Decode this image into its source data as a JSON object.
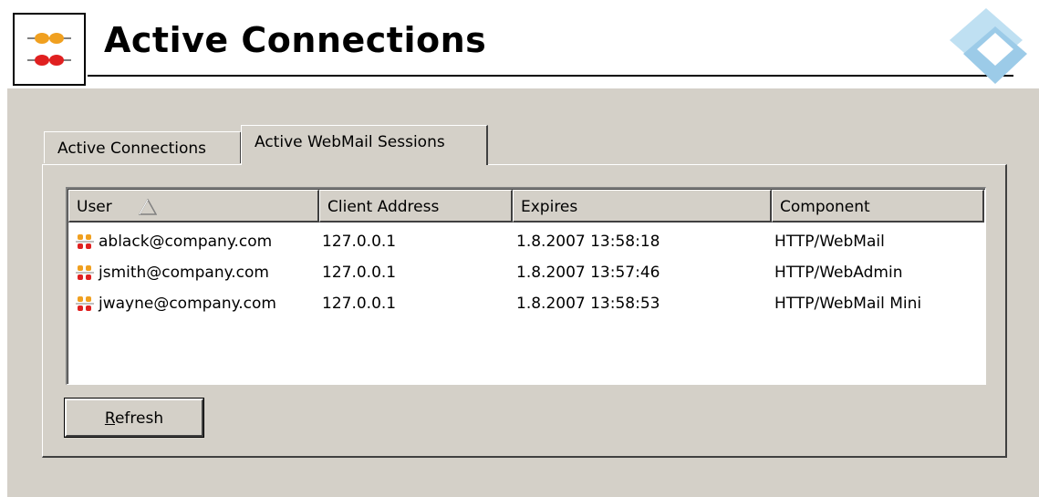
{
  "header": {
    "title": "Active Connections",
    "icon": "connections-icon",
    "logo": "brand-logo"
  },
  "tabs": [
    {
      "label": "Active Connections",
      "active": false
    },
    {
      "label": "Active WebMail Sessions",
      "active": true
    }
  ],
  "table": {
    "columns": [
      "User",
      "Client Address",
      "Expires",
      "Component"
    ],
    "sort_column": "User",
    "sort_direction": "ascending",
    "rows": [
      {
        "user": "ablack@company.com",
        "client_address": "127.0.0.1",
        "expires": "1.8.2007 13:58:18",
        "component": "HTTP/WebMail"
      },
      {
        "user": "jsmith@company.com",
        "client_address": "127.0.0.1",
        "expires": "1.8.2007 13:57:46",
        "component": "HTTP/WebAdmin"
      },
      {
        "user": "jwayne@company.com",
        "client_address": "127.0.0.1",
        "expires": "1.8.2007 13:58:53",
        "component": "HTTP/WebMail Mini"
      }
    ]
  },
  "buttons": {
    "refresh_accel": "R",
    "refresh_rest": "efresh"
  },
  "colors": {
    "face": "#d4d0c8",
    "shadow": "#404040",
    "highlight": "#ffffff",
    "icon_orange": "#f0a020",
    "icon_red": "#e02020",
    "logo_blue": "#9ccbe8"
  }
}
